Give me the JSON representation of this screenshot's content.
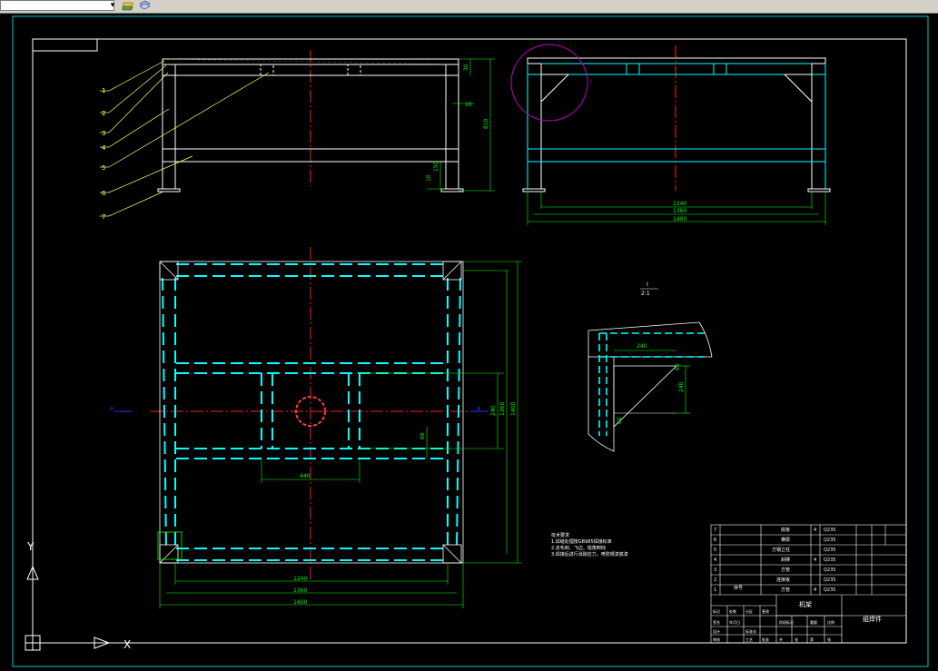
{
  "toolbar": {
    "combo_value": "",
    "icons": [
      "layer-state-icon",
      "layer-stack-icon"
    ]
  },
  "drawing": {
    "colors": {
      "frame": "#ffffff",
      "border": "#00c8c8",
      "part": "#00ffff",
      "hidden": "#00ffff",
      "center": "#ff2020",
      "dim": "#00ff00",
      "leader": "#ffff66",
      "detail_circle": "#c000c0",
      "axis_marker": "#3030ff"
    },
    "front_view": {
      "leaders": [
        "1",
        "2",
        "3",
        "4",
        "5",
        "6",
        "7"
      ],
      "dims": {
        "top": "30",
        "mid": "10",
        "height": "810",
        "low": "150",
        "foot": "10"
      }
    },
    "side_view": {
      "dims": [
        "1240",
        "1360",
        "1400"
      ]
    },
    "plan_view": {
      "dims_bottom": [
        "1240",
        "1360",
        "1400"
      ],
      "dim_inner": "440",
      "dims_right": [
        "240",
        "1360",
        "1400"
      ],
      "dim_small": "60",
      "section_left": "A",
      "section_right": "A"
    },
    "detail_view": {
      "label": "I",
      "scale": "2:1",
      "dims": {
        "horizontal": "240",
        "vertical": "240",
        "small_top": "60",
        "small_left": "60"
      }
    },
    "notes": {
      "title": "技术要求",
      "lines": [
        "1.焊缝处理按GB985焊接标准",
        "2.去毛刺、飞边，锐角倒钝",
        "3.焊接后进行消除应力，喷防锈漆底漆"
      ]
    },
    "title_block": {
      "title": "机架",
      "name": "组焊件",
      "rows": [
        {
          "no": "7",
          "part": "底板",
          "qty": "4",
          "mat": "Q235"
        },
        {
          "no": "6",
          "part": "横梁",
          "qty": "",
          "mat": "Q235"
        },
        {
          "no": "5",
          "part": "方钢立柱",
          "qty": "",
          "mat": "Q235"
        },
        {
          "no": "4",
          "part": "斜撑",
          "qty": "4",
          "mat": "Q235"
        },
        {
          "no": "3",
          "part": "方管",
          "qty": "",
          "mat": "Q235"
        },
        {
          "no": "2",
          "part": "连接板",
          "qty": "",
          "mat": "Q235"
        },
        {
          "no": "1",
          "part": "方管",
          "qty": "4",
          "mat": "Q235"
        }
      ],
      "header": "序号",
      "bottom": [
        "标记",
        "处数",
        "分区",
        "更改",
        "签名",
        "年月日",
        "设计",
        "标准化",
        "审核",
        "工艺",
        "批准",
        "阶段标记",
        "重量",
        "比例",
        "共",
        "张",
        "第",
        "张"
      ]
    },
    "ucs": {
      "x": "X",
      "y": "Y"
    }
  }
}
